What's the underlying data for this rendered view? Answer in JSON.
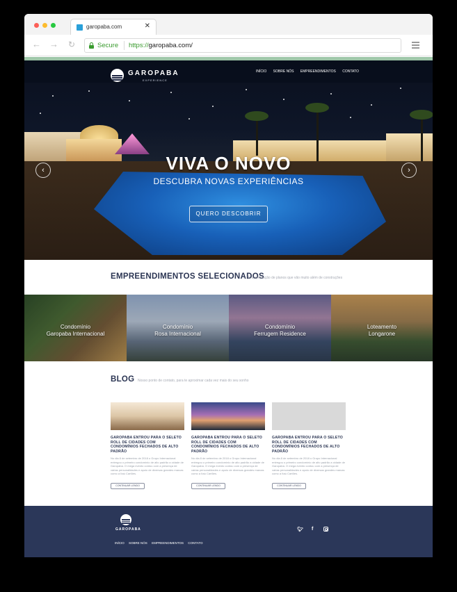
{
  "browser": {
    "tab_title": "garopaba.com",
    "secure_label": "Secure",
    "url_protocol": "https://",
    "url_rest": "garopaba.com/"
  },
  "header": {
    "logo_name": "GAROPABA",
    "logo_sub": "EXPERIENCE",
    "menu": [
      "INÍCIO",
      "SOBRE NÓS",
      "EMPREENDIMENTOS",
      "CONTATO"
    ]
  },
  "hero": {
    "title": "VIVA O NOVO",
    "subtitle": "DESCUBRA NOVAS EXPERIÊNCIAS",
    "button_label": "QUERO DESCOBRIR"
  },
  "projects": {
    "title": "EMPREENDIMENTOS SELECIONADOS",
    "description": "É a efetivação de planos que vão muito além de construções",
    "items": [
      {
        "line1": "Condomínio",
        "line2": "Garopaba Internacional"
      },
      {
        "line1": "Condomínio",
        "line2": "Rosa Internacional"
      },
      {
        "line1": "Condomínio",
        "line2": "Ferrugem Residence"
      },
      {
        "line1": "Loteamento",
        "line2": "Longarone"
      }
    ]
  },
  "blog": {
    "title": "BLOG",
    "description": "Nosso ponto de contato, para te aproximar cada vez mais do seu sonho",
    "posts": [
      {
        "title": "GAROPABA ENTROU PARA O SELETO ROLL DE CIDADES COM CONDOMÍNIOS FECHADOS DE ALTO PADRÃO",
        "excerpt": "No dia 8 de setembro de 2018 o Grupo Internacional entregou o primeiro condomínio de alto padrão a cidade de Garopaba. O mega evento contou com a presença de várias personalidades e apoio de diversas grandes marcas como a Itaú Cartões.",
        "button": "CONTINUAR LENDO"
      },
      {
        "title": "GAROPABA ENTROU PARA O SELETO ROLL DE CIDADES COM CONDOMÍNIOS FECHADOS DE ALTO PADRÃO",
        "excerpt": "No dia 8 de setembro de 2018 o Grupo Internacional entregou o primeiro condomínio de alto padrão a cidade de Garopaba. O mega evento contou com a presença de várias personalidades e apoio de diversas grandes marcas como a Itaú Cartões.",
        "button": "CONTINUAR LENDO"
      },
      {
        "title": "GAROPABA ENTROU PARA O SELETO ROLL DE CIDADES COM CONDOMÍNIOS FECHADOS DE ALTO PADRÃO",
        "excerpt": "No dia 8 de setembro de 2018 o Grupo Internacional entregou o primeiro condomínio de alto padrão a cidade de Garopaba. O mega evento contou com a presença de várias personalidades e apoio de diversas grandes marcas como a Itaú Cartões.",
        "button": "CONTINUAR LENDO"
      }
    ]
  },
  "footer": {
    "logo_name": "GAROPABA",
    "menu": [
      "INÍCIO",
      "SOBRE NÓS",
      "EMPREENDIMENTOS",
      "CONTATO"
    ],
    "social": [
      "twitter-icon",
      "facebook-icon",
      "instagram-icon"
    ]
  },
  "colors": {
    "brand_navy": "#2b3759",
    "secure_green": "#3a9b2f"
  }
}
